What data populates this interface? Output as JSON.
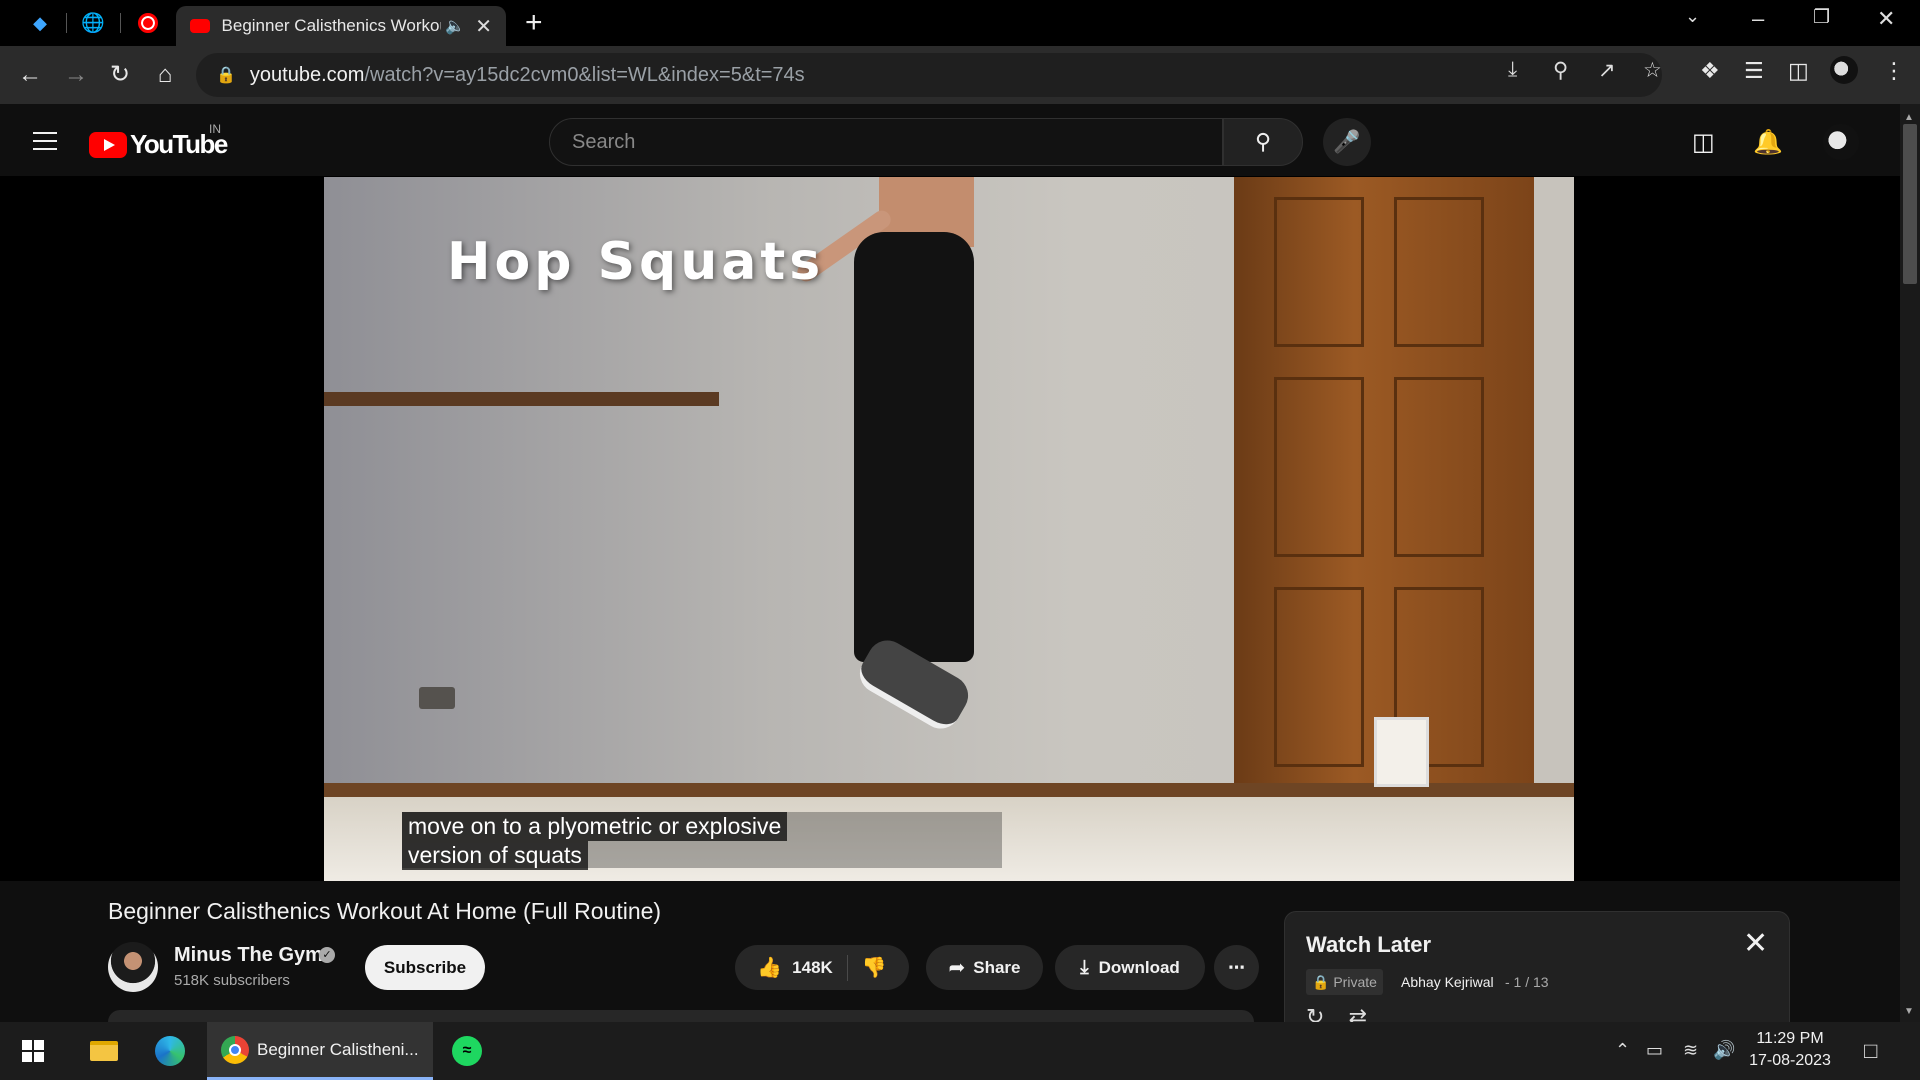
{
  "browser": {
    "tab_title": "Beginner Calisthenics Workout At Home (Full Routine)",
    "url_host": "youtube.com",
    "url_path": "/watch?v=ay15dc2cvm0&list=WL&index=5&t=74s"
  },
  "youtube": {
    "logo_text": "YouTube",
    "country_code": "IN",
    "search_placeholder": "Search"
  },
  "video": {
    "overlay_title": "Hop Squats",
    "caption_line1": "move on to a plyometric or explosive",
    "caption_line2": "version of squats",
    "title": "Beginner Calisthenics Workout At Home (Full Routine)"
  },
  "channel": {
    "name": "Minus The Gym",
    "subscribers": "518K subscribers",
    "subscribe_label": "Subscribe"
  },
  "actions": {
    "likes": "148K",
    "share_label": "Share",
    "download_label": "Download"
  },
  "playlist": {
    "title": "Watch Later",
    "privacy": "Private",
    "owner": "Abhay Kejriwal",
    "position": "- 1 / 13"
  },
  "taskbar": {
    "chrome_label": "Beginner Calistheni...",
    "time": "11:29 PM",
    "date": "17-08-2023"
  },
  "colors": {
    "youtube_red": "#ff0000",
    "page_bg": "#0f0f0f",
    "taskbar_accent": "#8ab4f8"
  }
}
